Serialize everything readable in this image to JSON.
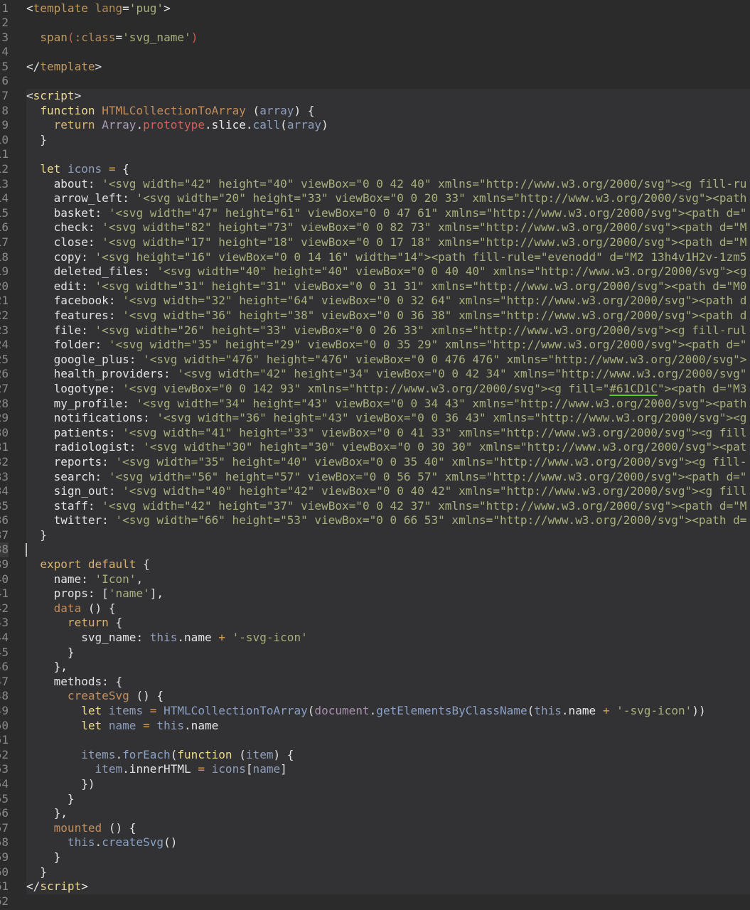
{
  "editor": {
    "cursor_line": 38,
    "script_block_lines": [
      7,
      61
    ],
    "colors": {
      "background": "#2b2b2c",
      "script_block": "#323234",
      "string": "#a6b07c",
      "keyword": "#ecd98c",
      "color_swatch_underline": "#61CD1C"
    },
    "lines": [
      [
        [
          "p",
          "<"
        ],
        [
          "tg",
          "template"
        ],
        [
          "p",
          " "
        ],
        [
          "at",
          "lang"
        ],
        [
          "p",
          "="
        ],
        [
          "s",
          "'pug'"
        ],
        [
          "p",
          ">"
        ]
      ],
      [],
      [
        [
          "p",
          "  "
        ],
        [
          "tg",
          "span"
        ],
        [
          "red",
          "("
        ],
        [
          "at",
          ":class"
        ],
        [
          "p",
          "="
        ],
        [
          "s",
          "'svg_name'"
        ],
        [
          "red",
          ")"
        ]
      ],
      [],
      [
        [
          "p",
          "</"
        ],
        [
          "tg",
          "template"
        ],
        [
          "p",
          ">"
        ]
      ],
      [],
      [
        [
          "p",
          "<"
        ],
        [
          "k",
          "script"
        ],
        [
          "p",
          ">"
        ]
      ],
      [
        [
          "p",
          "  "
        ],
        [
          "k",
          "function"
        ],
        [
          "p",
          " "
        ],
        [
          "fn",
          "HTMLCollectionToArray"
        ],
        [
          "p",
          " ("
        ],
        [
          "v",
          "array"
        ],
        [
          "p",
          ") {"
        ]
      ],
      [
        [
          "p",
          "    "
        ],
        [
          "ex",
          "return"
        ],
        [
          "p",
          " "
        ],
        [
          "cls",
          "Array"
        ],
        [
          "p",
          "."
        ],
        [
          "pr",
          "prototype"
        ],
        [
          "p",
          ".slice."
        ],
        [
          "m",
          "call"
        ],
        [
          "p",
          "("
        ],
        [
          "v",
          "array"
        ],
        [
          "p",
          ")"
        ]
      ],
      [
        [
          "p",
          "  }"
        ]
      ],
      [],
      [
        [
          "p",
          "  "
        ],
        [
          "k",
          "let"
        ],
        [
          "p",
          " "
        ],
        [
          "v",
          "icons"
        ],
        [
          "op",
          " ="
        ],
        [
          "p",
          " {"
        ]
      ],
      [
        [
          "key",
          "    about"
        ],
        [
          "p",
          ": "
        ],
        [
          "s",
          "'<svg width=\"42\" height=\"40\" viewBox=\"0 0 42 40\" xmlns=\"http://www.w3.org/2000/svg\"><g fill-ru"
        ]
      ],
      [
        [
          "key",
          "    arrow_left"
        ],
        [
          "p",
          ": "
        ],
        [
          "s",
          "'<svg width=\"20\" height=\"33\" viewBox=\"0 0 20 33\" xmlns=\"http://www.w3.org/2000/svg\"><path"
        ]
      ],
      [
        [
          "key",
          "    basket"
        ],
        [
          "p",
          ": "
        ],
        [
          "s",
          "'<svg width=\"47\" height=\"61\" viewBox=\"0 0 47 61\" xmlns=\"http://www.w3.org/2000/svg\"><path d=\""
        ]
      ],
      [
        [
          "key",
          "    check"
        ],
        [
          "p",
          ": "
        ],
        [
          "s",
          "'<svg width=\"82\" height=\"73\" viewBox=\"0 0 82 73\" xmlns=\"http://www.w3.org/2000/svg\"><path d=\"M"
        ]
      ],
      [
        [
          "key",
          "    close"
        ],
        [
          "p",
          ": "
        ],
        [
          "s",
          "'<svg width=\"17\" height=\"18\" viewBox=\"0 0 17 18\" xmlns=\"http://www.w3.org/2000/svg\"><path d=\"M"
        ]
      ],
      [
        [
          "key",
          "    copy"
        ],
        [
          "p",
          ": "
        ],
        [
          "s",
          "'<svg height=\"16\" viewBox=\"0 0 14 16\" width=\"14\"><path fill-rule=\"evenodd\" d=\"M2 13h4v1H2v-1zm5"
        ]
      ],
      [
        [
          "key",
          "    deleted_files"
        ],
        [
          "p",
          ": "
        ],
        [
          "s",
          "'<svg width=\"40\" height=\"40\" viewBox=\"0 0 40 40\" xmlns=\"http://www.w3.org/2000/svg\"><g"
        ]
      ],
      [
        [
          "key",
          "    edit"
        ],
        [
          "p",
          ": "
        ],
        [
          "s",
          "'<svg width=\"31\" height=\"31\" viewBox=\"0 0 31 31\" xmlns=\"http://www.w3.org/2000/svg\"><path d=\"M0"
        ]
      ],
      [
        [
          "key",
          "    facebook"
        ],
        [
          "p",
          ": "
        ],
        [
          "s",
          "'<svg width=\"32\" height=\"64\" viewBox=\"0 0 32 64\" xmlns=\"http://www.w3.org/2000/svg\"><path d"
        ]
      ],
      [
        [
          "key",
          "    features"
        ],
        [
          "p",
          ": "
        ],
        [
          "s",
          "'<svg width=\"36\" height=\"38\" viewBox=\"0 0 36 38\" xmlns=\"http://www.w3.org/2000/svg\"><path d"
        ]
      ],
      [
        [
          "key",
          "    file"
        ],
        [
          "p",
          ": "
        ],
        [
          "s",
          "'<svg width=\"26\" height=\"33\" viewBox=\"0 0 26 33\" xmlns=\"http://www.w3.org/2000/svg\"><g fill-rul"
        ]
      ],
      [
        [
          "key",
          "    folder"
        ],
        [
          "p",
          ": "
        ],
        [
          "s",
          "'<svg width=\"35\" height=\"29\" viewBox=\"0 0 35 29\" xmlns=\"http://www.w3.org/2000/svg\"><path d=\""
        ]
      ],
      [
        [
          "key",
          "    google_plus"
        ],
        [
          "p",
          ": "
        ],
        [
          "s",
          "'<svg width=\"476\" height=\"476\" viewBox=\"0 0 476 476\" xmlns=\"http://www.w3.org/2000/svg\">"
        ]
      ],
      [
        [
          "key",
          "    health_providers"
        ],
        [
          "p",
          ": "
        ],
        [
          "s",
          "'<svg width=\"42\" height=\"34\" viewBox=\"0 0 42 34\" xmlns=\"http://www.w3.org/2000/svg\""
        ]
      ],
      [
        [
          "key",
          "    logotype"
        ],
        [
          "p",
          ": "
        ],
        [
          "s",
          "'<svg viewBox=\"0 0 142 93\" xmlns=\"http://www.w3.org/2000/svg\"><g fill=\""
        ],
        [
          "ul",
          "#61CD1C"
        ],
        [
          "s",
          "\"><path d=\"M3"
        ]
      ],
      [
        [
          "key",
          "    my_profile"
        ],
        [
          "p",
          ": "
        ],
        [
          "s",
          "'<svg width=\"34\" height=\"43\" viewBox=\"0 0 34 43\" xmlns=\"http://www.w3.org/2000/svg\"><path"
        ]
      ],
      [
        [
          "key",
          "    notifications"
        ],
        [
          "p",
          ": "
        ],
        [
          "s",
          "'<svg width=\"36\" height=\"43\" viewBox=\"0 0 36 43\" xmlns=\"http://www.w3.org/2000/svg\"><g"
        ]
      ],
      [
        [
          "key",
          "    patients"
        ],
        [
          "p",
          ": "
        ],
        [
          "s",
          "'<svg width=\"41\" height=\"33\" viewBox=\"0 0 41 33\" xmlns=\"http://www.w3.org/2000/svg\"><g fill"
        ]
      ],
      [
        [
          "key",
          "    radiologist"
        ],
        [
          "p",
          ": "
        ],
        [
          "s",
          "'<svg width=\"30\" height=\"30\" viewBox=\"0 0 30 30\" xmlns=\"http://www.w3.org/2000/svg\"><pat"
        ]
      ],
      [
        [
          "key",
          "    reports"
        ],
        [
          "p",
          ": "
        ],
        [
          "s",
          "'<svg width=\"35\" height=\"40\" viewBox=\"0 0 35 40\" xmlns=\"http://www.w3.org/2000/svg\"><g fill-"
        ]
      ],
      [
        [
          "key",
          "    search"
        ],
        [
          "p",
          ": "
        ],
        [
          "s",
          "'<svg width=\"56\" height=\"57\" viewBox=\"0 0 56 57\" xmlns=\"http://www.w3.org/2000/svg\"><path d=\""
        ]
      ],
      [
        [
          "key",
          "    sign_out"
        ],
        [
          "p",
          ": "
        ],
        [
          "s",
          "'<svg width=\"40\" height=\"42\" viewBox=\"0 0 40 42\" xmlns=\"http://www.w3.org/2000/svg\"><g fill"
        ]
      ],
      [
        [
          "key",
          "    staff"
        ],
        [
          "p",
          ": "
        ],
        [
          "s",
          "'<svg width=\"42\" height=\"37\" viewBox=\"0 0 42 37\" xmlns=\"http://www.w3.org/2000/svg\"><path d=\"M"
        ]
      ],
      [
        [
          "key",
          "    twitter"
        ],
        [
          "p",
          ": "
        ],
        [
          "s",
          "'<svg width=\"66\" height=\"53\" viewBox=\"0 0 66 53\" xmlns=\"http://www.w3.org/2000/svg\"><path d="
        ]
      ],
      [
        [
          "p",
          "  }"
        ]
      ],
      [],
      [
        [
          "p",
          "  "
        ],
        [
          "ex",
          "export default"
        ],
        [
          "p",
          " {"
        ]
      ],
      [
        [
          "key",
          "    name"
        ],
        [
          "p",
          ": "
        ],
        [
          "s",
          "'Icon'"
        ],
        [
          "p",
          ","
        ]
      ],
      [
        [
          "key",
          "    props"
        ],
        [
          "p",
          ": ["
        ],
        [
          "s",
          "'name'"
        ],
        [
          "p",
          "],"
        ]
      ],
      [
        [
          "p",
          "    "
        ],
        [
          "fn",
          "data"
        ],
        [
          "p",
          " () {"
        ]
      ],
      [
        [
          "p",
          "      "
        ],
        [
          "ex",
          "return"
        ],
        [
          "p",
          " {"
        ]
      ],
      [
        [
          "key",
          "        svg_name"
        ],
        [
          "p",
          ": "
        ],
        [
          "v",
          "this"
        ],
        [
          "p",
          ".name "
        ],
        [
          "op",
          "+"
        ],
        [
          "p",
          " "
        ],
        [
          "s",
          "'-svg-icon'"
        ]
      ],
      [
        [
          "p",
          "      }"
        ]
      ],
      [
        [
          "p",
          "    },"
        ]
      ],
      [
        [
          "key",
          "    methods"
        ],
        [
          "p",
          ": {"
        ]
      ],
      [
        [
          "p",
          "      "
        ],
        [
          "fn",
          "createSvg"
        ],
        [
          "p",
          " () {"
        ]
      ],
      [
        [
          "p",
          "        "
        ],
        [
          "k",
          "let"
        ],
        [
          "p",
          " "
        ],
        [
          "v",
          "items"
        ],
        [
          "op",
          " ="
        ],
        [
          "p",
          " "
        ],
        [
          "m",
          "HTMLCollectionToArray"
        ],
        [
          "p",
          "("
        ],
        [
          "doc",
          "document"
        ],
        [
          "p",
          "."
        ],
        [
          "m",
          "getElementsByClassName"
        ],
        [
          "p",
          "("
        ],
        [
          "v",
          "this"
        ],
        [
          "p",
          ".name "
        ],
        [
          "op",
          "+"
        ],
        [
          "p",
          " "
        ],
        [
          "s",
          "'-svg-icon'"
        ],
        [
          "p",
          "))"
        ]
      ],
      [
        [
          "p",
          "        "
        ],
        [
          "k",
          "let"
        ],
        [
          "p",
          " "
        ],
        [
          "v",
          "name"
        ],
        [
          "op",
          " ="
        ],
        [
          "p",
          " "
        ],
        [
          "v",
          "this"
        ],
        [
          "p",
          ".name"
        ]
      ],
      [],
      [
        [
          "p",
          "        "
        ],
        [
          "v",
          "items"
        ],
        [
          "p",
          "."
        ],
        [
          "m",
          "forEach"
        ],
        [
          "p",
          "("
        ],
        [
          "k",
          "function"
        ],
        [
          "p",
          " ("
        ],
        [
          "v",
          "item"
        ],
        [
          "p",
          ") {"
        ]
      ],
      [
        [
          "p",
          "          "
        ],
        [
          "v",
          "item"
        ],
        [
          "p",
          ".innerHTML "
        ],
        [
          "op",
          "="
        ],
        [
          "p",
          " "
        ],
        [
          "v",
          "icons"
        ],
        [
          "p",
          "["
        ],
        [
          "v",
          "name"
        ],
        [
          "p",
          "]"
        ]
      ],
      [
        [
          "p",
          "        })"
        ]
      ],
      [
        [
          "p",
          "      }"
        ]
      ],
      [
        [
          "p",
          "    },"
        ]
      ],
      [
        [
          "p",
          "    "
        ],
        [
          "fn",
          "mounted"
        ],
        [
          "p",
          " () {"
        ]
      ],
      [
        [
          "p",
          "      "
        ],
        [
          "v",
          "this"
        ],
        [
          "p",
          "."
        ],
        [
          "m",
          "createSvg"
        ],
        [
          "p",
          "()"
        ]
      ],
      [
        [
          "p",
          "    }"
        ]
      ],
      [
        [
          "p",
          "  }"
        ]
      ],
      [
        [
          "p",
          "</"
        ],
        [
          "k",
          "script"
        ],
        [
          "p",
          ">"
        ]
      ],
      []
    ]
  }
}
